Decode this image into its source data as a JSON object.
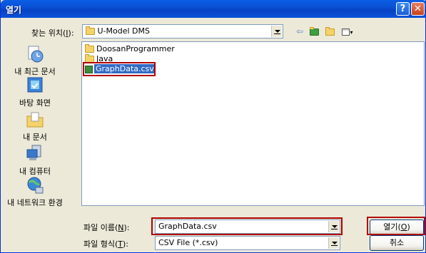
{
  "window": {
    "title": "열기"
  },
  "lookin": {
    "label_prefix": "찾는 위치(",
    "label_key": "I",
    "label_suffix": "):",
    "value": "U-Model DMS"
  },
  "places": [
    {
      "label": "내 최근 문서",
      "icon": "recent-documents-icon"
    },
    {
      "label": "바탕 화면",
      "icon": "desktop-icon"
    },
    {
      "label": "내 문서",
      "icon": "my-documents-icon"
    },
    {
      "label": "내 컴퓨터",
      "icon": "my-computer-icon"
    },
    {
      "label": "내 네트워크 환경",
      "icon": "network-icon"
    }
  ],
  "files": [
    {
      "name": "DoosanProgrammer",
      "type": "folder"
    },
    {
      "name": "Java",
      "type": "folder"
    },
    {
      "name": "GraphData.csv",
      "type": "csv",
      "selected": true
    }
  ],
  "filename": {
    "label_prefix": "파일 이름(",
    "label_key": "N",
    "label_suffix": "):",
    "value": "GraphData.csv"
  },
  "filetype": {
    "label_prefix": "파일 형식(",
    "label_key": "T",
    "label_suffix": "):",
    "value": "CSV File (*.csv)"
  },
  "buttons": {
    "open_prefix": "열기(",
    "open_key": "O",
    "open_suffix": ")",
    "cancel": "취소"
  },
  "colors": {
    "titlebar": "#0a4ed2",
    "highlight": "#b00000",
    "selection": "#316ac5"
  }
}
